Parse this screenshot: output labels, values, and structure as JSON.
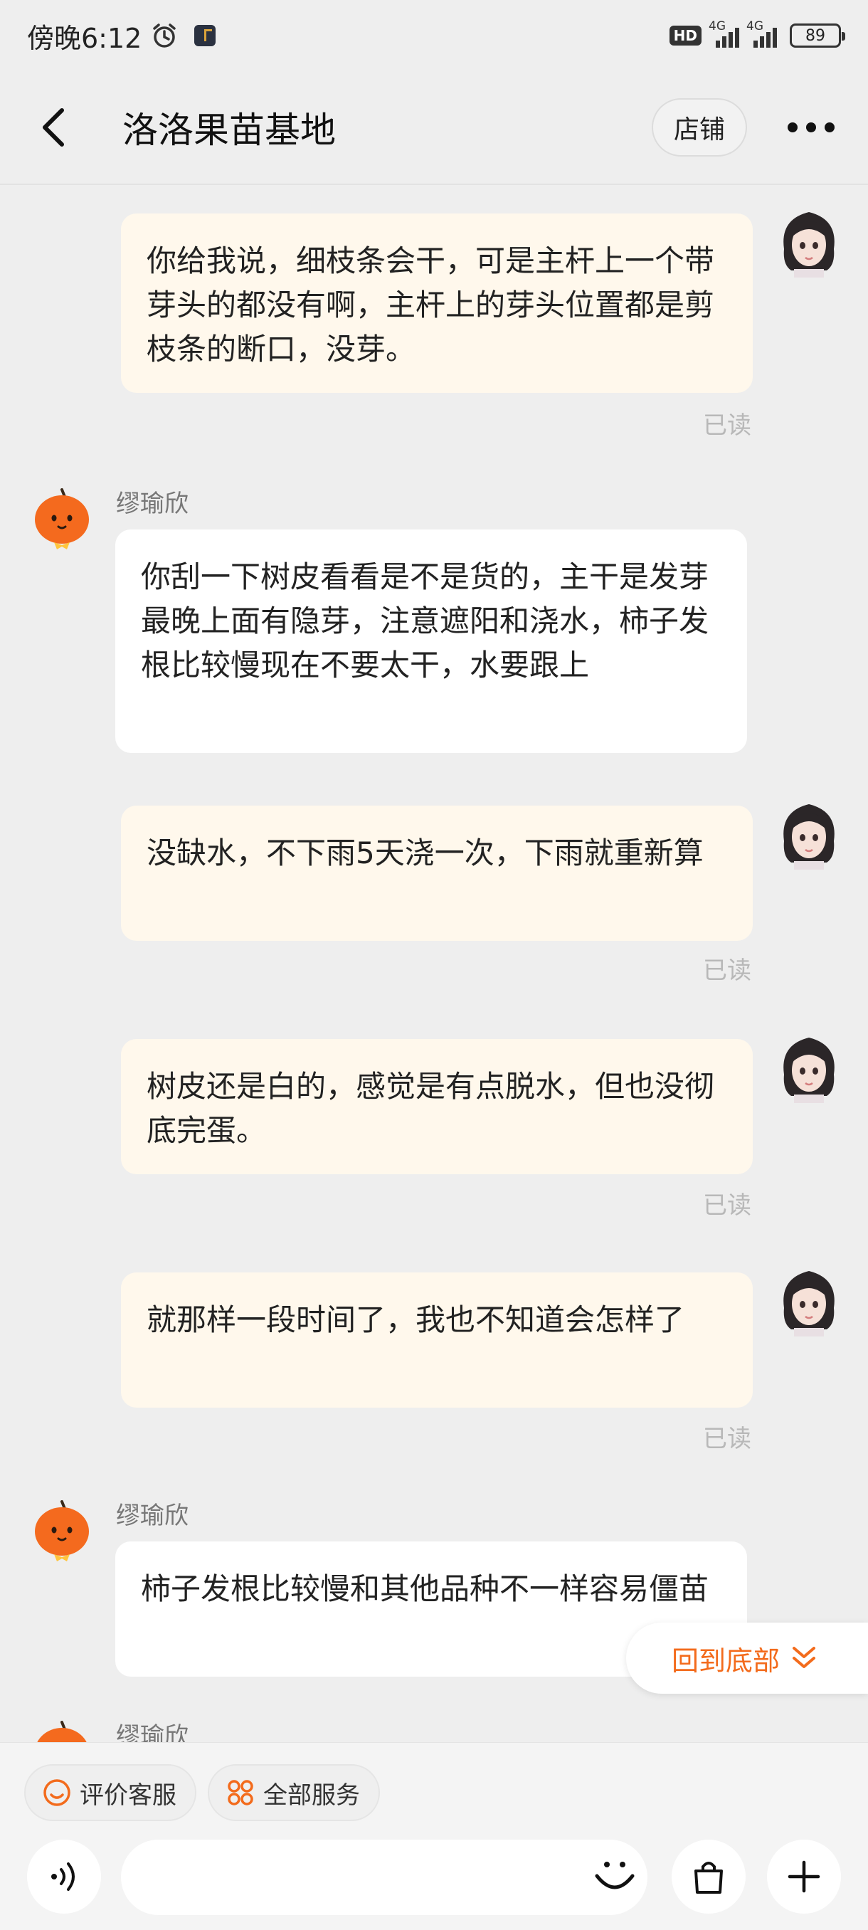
{
  "status_bar": {
    "time": "傍晚6:12",
    "hd_label": "HD",
    "net_1": "4G",
    "net_2": "4G",
    "battery": "89"
  },
  "header": {
    "title": "洛洛果苗基地",
    "store_label": "店铺"
  },
  "messages": [
    {
      "from": "me",
      "text": "你给我说，细枝条会干，可是主杆上一个带芽头的都没有啊，主杆上的芽头位置都是剪枝条的断口，没芽。",
      "status": "已读"
    },
    {
      "from": "them",
      "sender": "缪瑜欣",
      "text": "你刮一下树皮看看是不是货的，主干是发芽最晚上面有隐芽，注意遮阳和浇水，柿子发根比较慢现在不要太干，水要跟上"
    },
    {
      "from": "me",
      "text": "没缺水，不下雨5天浇一次，下雨就重新算",
      "status": "已读"
    },
    {
      "from": "me",
      "text": "树皮还是白的，感觉是有点脱水，但也没彻底完蛋。",
      "status": "已读"
    },
    {
      "from": "me",
      "text": "就那样一段时间了，我也不知道会怎样了",
      "status": "已读"
    },
    {
      "from": "them",
      "sender": "缪瑜欣",
      "text": "柿子发根比较慢和其他品种不一样容易僵苗"
    },
    {
      "from": "them",
      "sender": "缪瑜欣",
      "text": ""
    }
  ],
  "scroll_to_bottom": "回到底部",
  "quick_actions": [
    {
      "label": "评价客服",
      "icon": "smile-icon"
    },
    {
      "label": "全部服务",
      "icon": "grid-icon"
    }
  ],
  "colors": {
    "accent": "#f36b1c",
    "my_bubble": "#fff8ec",
    "their_bubble": "#ffffff",
    "background": "#eeeeee"
  }
}
